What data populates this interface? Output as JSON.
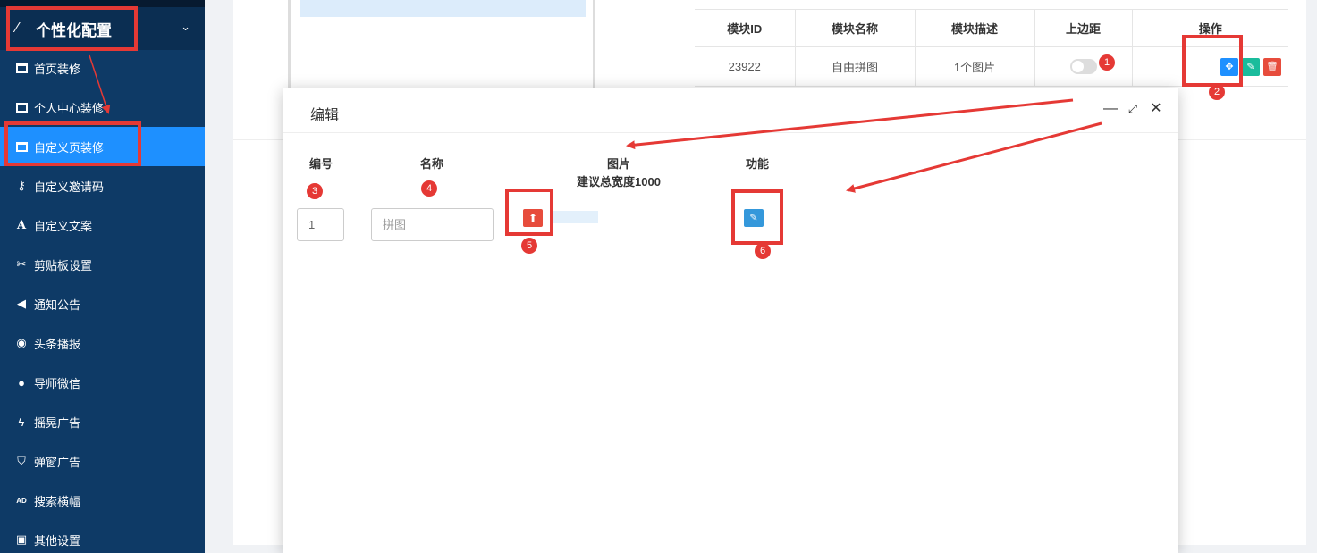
{
  "sidebar": {
    "section": {
      "label": "个性化配置"
    },
    "items": [
      {
        "label": "首页装修",
        "icon": "window-icon"
      },
      {
        "label": "个人中心装修",
        "icon": "window-icon"
      },
      {
        "label": "自定义页装修",
        "icon": "window-icon",
        "active": true
      },
      {
        "label": "自定义邀请码",
        "icon": "key-icon"
      },
      {
        "label": "自定义文案",
        "icon": "font-icon"
      },
      {
        "label": "剪贴板设置",
        "icon": "scissors-icon"
      },
      {
        "label": "通知公告",
        "icon": "bullhorn-icon"
      },
      {
        "label": "头条播报",
        "icon": "podcast-icon"
      },
      {
        "label": "导师微信",
        "icon": "wechat-icon"
      },
      {
        "label": "摇晃广告",
        "icon": "bolt-icon"
      },
      {
        "label": "弹窗广告",
        "icon": "shield-icon"
      },
      {
        "label": "搜索横幅",
        "icon": "ad-icon"
      },
      {
        "label": "其他设置",
        "icon": "image-icon"
      }
    ]
  },
  "table": {
    "headers": [
      "模块ID",
      "模块名称",
      "模块描述",
      "上边距",
      "操作"
    ],
    "rows": [
      {
        "id": "23922",
        "name": "自由拼图",
        "desc": "1个图片"
      }
    ]
  },
  "modal": {
    "title": "编辑",
    "columns": {
      "number": "编号",
      "name": "名称",
      "image": "图片",
      "image_hint": "建议总宽度1000",
      "function": "功能"
    },
    "row": {
      "number_value": "1",
      "name_placeholder": "拼图"
    }
  },
  "annotations": [
    "1",
    "2",
    "3",
    "4",
    "5",
    "6"
  ],
  "colors": {
    "sidebar_bg": "#0e3a66",
    "active_item": "#1e90ff",
    "annotation_red": "#e53935",
    "upload_red": "#e74c3c",
    "edit_green": "#1abc9c",
    "func_blue": "#3498db"
  }
}
